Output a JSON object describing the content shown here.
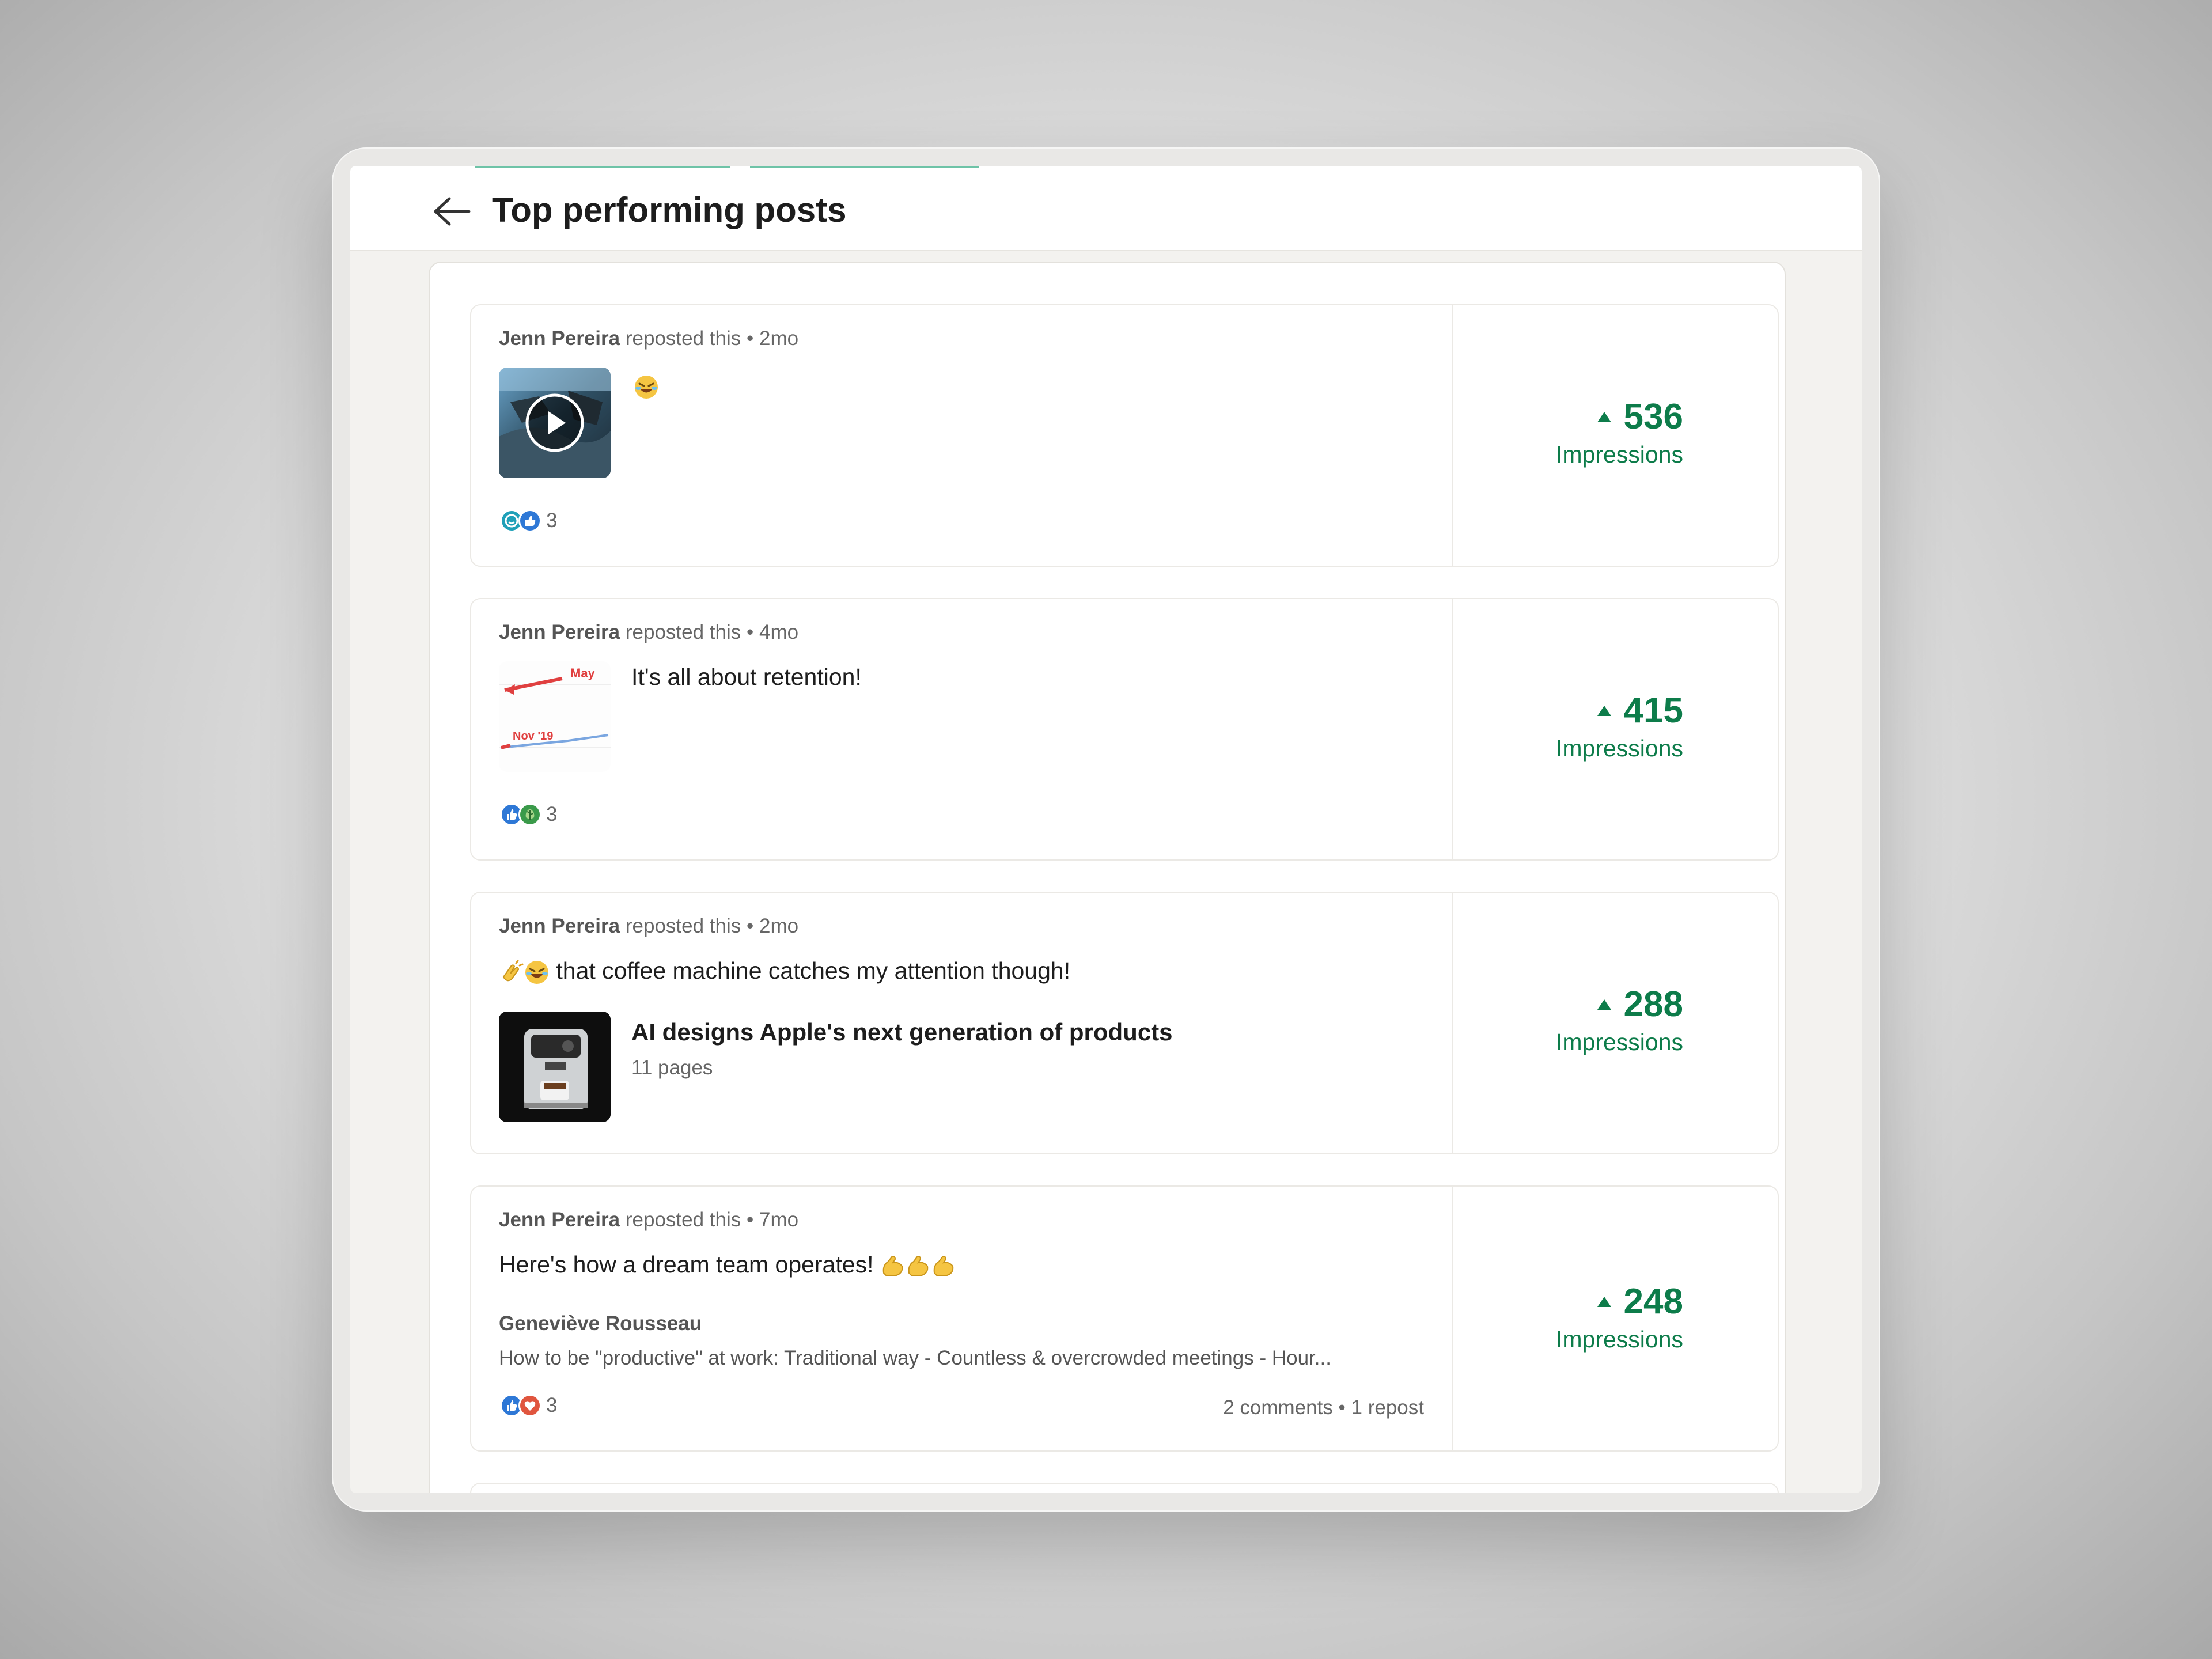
{
  "header": {
    "title": "Top performing posts",
    "back_icon": "arrow-left-icon"
  },
  "colors": {
    "accent_green": "#0d7c4a",
    "tab_underline": "#6ec3a7",
    "like_blue": "#2e78d6",
    "heart_red": "#e0553e"
  },
  "posts": [
    {
      "author": "Jenn Pereira",
      "action": "reposted this",
      "age": "2mo",
      "thumbnail": "video-thumbnail",
      "text_emoji": "laughing-face",
      "reaction_icons": [
        "funny-icon",
        "like-icon"
      ],
      "reaction_count": "3",
      "impressions": "536",
      "impressions_label": "Impressions"
    },
    {
      "author": "Jenn Pereira",
      "action": "reposted this",
      "age": "4mo",
      "thumbnail": "chart-thumbnail",
      "thumb_labels": [
        "May",
        "Nov '19"
      ],
      "text": "It's all about retention!",
      "reaction_icons": [
        "like-icon",
        "support-icon"
      ],
      "reaction_count": "3",
      "impressions": "415",
      "impressions_label": "Impressions"
    },
    {
      "author": "Jenn Pereira",
      "action": "reposted this",
      "age": "2mo",
      "text": "that coffee machine catches my attention though!",
      "text_emojis": [
        "clapping-hands",
        "laughing-face"
      ],
      "doc_title": "AI designs Apple's next generation of products",
      "doc_pages": "11 pages",
      "impressions": "288",
      "impressions_label": "Impressions"
    },
    {
      "author": "Jenn Pereira",
      "action": "reposted this",
      "age": "7mo",
      "text": "Here's how a dream team operates!",
      "text_emojis": [
        "flexed-biceps",
        "flexed-biceps",
        "flexed-biceps"
      ],
      "quoted_author": "Geneviève Rousseau",
      "quoted_text": "How to be \"productive\" at work: Traditional way - Countless & overcrowded meetings - Hour...",
      "reaction_icons": [
        "like-icon",
        "love-icon"
      ],
      "reaction_count": "3",
      "activity": "2 comments • 1 repost",
      "impressions": "248",
      "impressions_label": "Impressions"
    }
  ]
}
